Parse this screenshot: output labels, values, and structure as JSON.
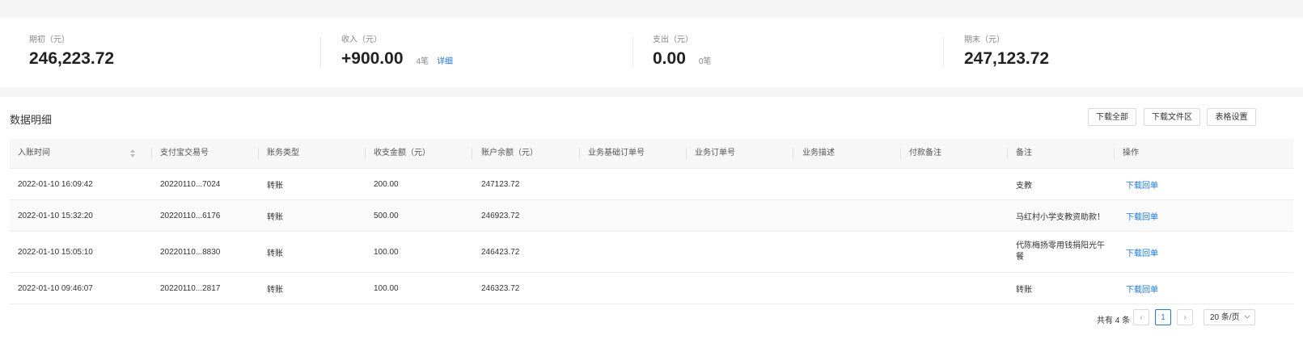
{
  "summary": {
    "opening": {
      "label": "期初（元）",
      "value": "246,223.72"
    },
    "income": {
      "label": "收入（元）",
      "value": "+900.00",
      "count": "4笔",
      "link": "详细"
    },
    "expense": {
      "label": "支出（元）",
      "value": "0.00",
      "count": "0笔"
    },
    "closing": {
      "label": "期末（元）",
      "value": "247,123.72"
    }
  },
  "detail": {
    "title": "数据明细",
    "buttons": {
      "download_all": "下载全部",
      "download_zone": "下载文件区",
      "table_settings": "表格设置"
    },
    "columns": [
      "入账时间",
      "支付宝交易号",
      "账务类型",
      "收支金额（元）",
      "账户余额（元）",
      "业务基础订单号",
      "业务订单号",
      "业务描述",
      "付款备注",
      "备注",
      "操作"
    ],
    "rows": [
      {
        "time": "2022-01-10 16:09:42",
        "trade_no": "20220110...7024",
        "type": "转账",
        "amount": "200.00",
        "balance": "247123.72",
        "base_order": "",
        "order": "",
        "desc": "",
        "pay_note": "",
        "note": "支教",
        "action": "下载回单"
      },
      {
        "time": "2022-01-10 15:32:20",
        "trade_no": "20220110...6176",
        "type": "转账",
        "amount": "500.00",
        "balance": "246923.72",
        "base_order": "",
        "order": "",
        "desc": "",
        "pay_note": "",
        "note": "马红村小学支教资助款！",
        "action": "下载回单"
      },
      {
        "time": "2022-01-10 15:05:10",
        "trade_no": "20220110...8830",
        "type": "转账",
        "amount": "100.00",
        "balance": "246423.72",
        "base_order": "",
        "order": "",
        "desc": "",
        "pay_note": "",
        "note": "代陈梅扬零用钱捐阳光午餐",
        "action": "下载回单"
      },
      {
        "time": "2022-01-10 09:46:07",
        "trade_no": "20220110...2817",
        "type": "转账",
        "amount": "100.00",
        "balance": "246323.72",
        "base_order": "",
        "order": "",
        "desc": "",
        "pay_note": "",
        "note": "转账",
        "action": "下载回单"
      }
    ],
    "pagination": {
      "total": "共有 4 条",
      "prev": "‹",
      "current": "1",
      "next": "›",
      "page_size": "20 条/页"
    }
  }
}
